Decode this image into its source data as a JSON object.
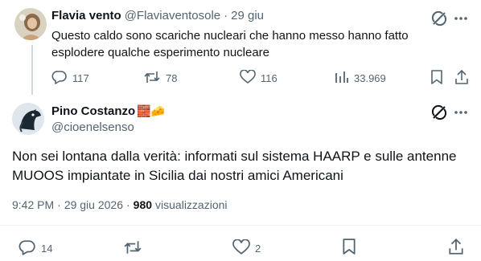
{
  "parent_tweet": {
    "author_name": "Flavia vento",
    "author_handle": "@Flaviaventosole",
    "separator": "·",
    "date": "29 giu",
    "text": "Questo caldo sono scariche nucleari che hanno messo hanno fatto esplodere qualche esperimento nucleare",
    "replies": "117",
    "reposts": "78",
    "likes": "116",
    "views": "33.969"
  },
  "main_tweet": {
    "author_name": "Pino Costanzo",
    "author_emojis": "🧱🧀",
    "author_handle": "@cioenelsenso",
    "text": "Non sei lontana dalla verità: informati sul sistema HAARP e sulle antenne MUOOS impiantate in Sicilia dai nostri amici Americani",
    "time": "9:42 PM",
    "separator": "·",
    "date": "29 giu 2026",
    "separator2": "·",
    "views_count": "980",
    "views_label": "visualizzazioni",
    "replies": "14",
    "likes": "2"
  },
  "colors": {
    "text": "#0f1419",
    "muted": "#536471",
    "divider": "#eff3f4",
    "thread_line": "#cfd9de"
  }
}
